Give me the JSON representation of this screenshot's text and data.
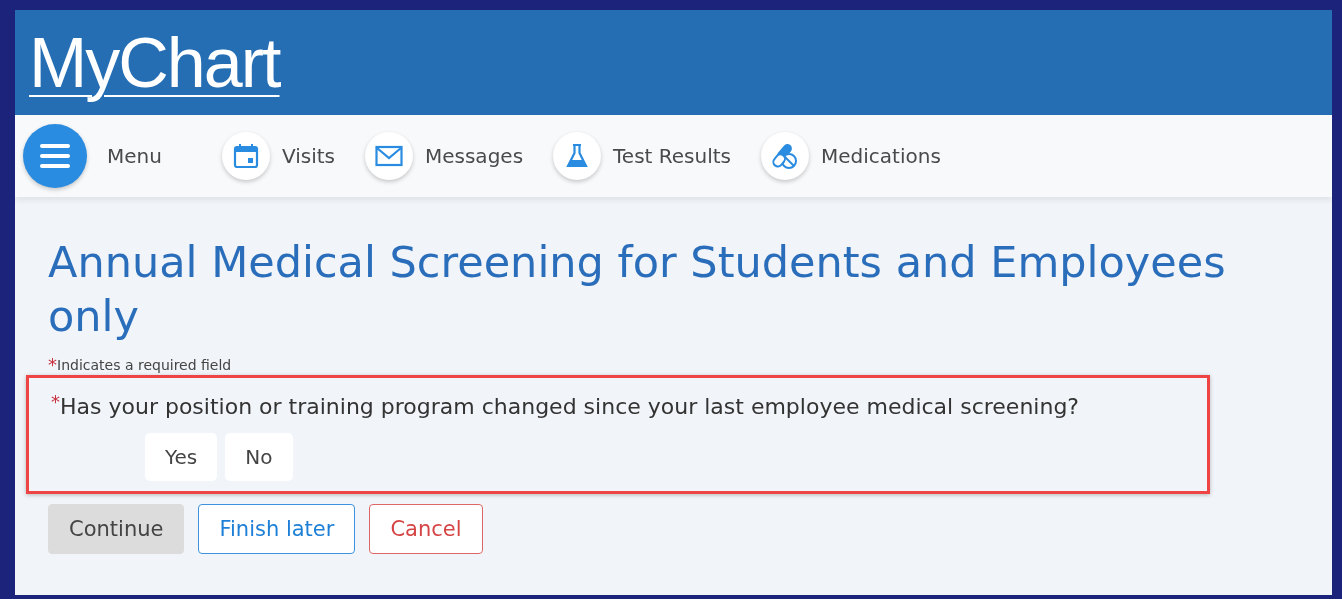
{
  "logo": {
    "text": "MyChart"
  },
  "nav": [
    {
      "label": "Menu",
      "kind": "menu"
    },
    {
      "label": "Visits",
      "kind": "calendar"
    },
    {
      "label": "Messages",
      "kind": "envelope"
    },
    {
      "label": "Test Results",
      "kind": "flask"
    },
    {
      "label": "Medications",
      "kind": "pills"
    }
  ],
  "page": {
    "title": "Annual Medical Screening for Students and Employees only",
    "required_mark": "*",
    "required_note": "Indicates a required field"
  },
  "question": {
    "required_mark": "*",
    "text": "Has your position or training program changed since your last employee medical screening?",
    "highlighted": true,
    "options": [
      {
        "label": "Yes",
        "selected": false
      },
      {
        "label": "No",
        "selected": false
      }
    ]
  },
  "actions": [
    {
      "label": "Continue",
      "kind": "primary",
      "disabled": true
    },
    {
      "label": "Finish later",
      "kind": "secondary",
      "disabled": false
    },
    {
      "label": "Cancel",
      "kind": "danger",
      "disabled": false
    }
  ]
}
